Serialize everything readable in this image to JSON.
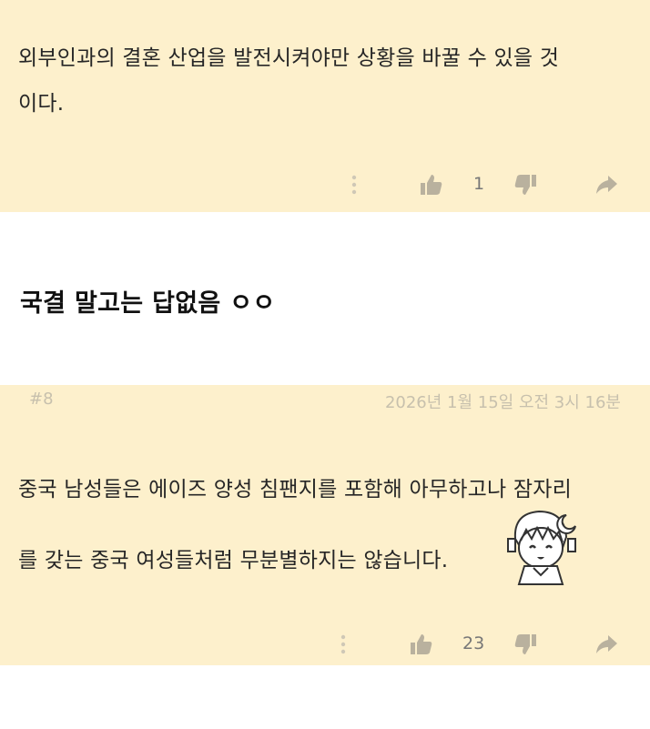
{
  "top_comment": {
    "text_lines": [
      "외부인과의 결혼 산업을 발전시켜야만 상황을 바꿀 수 있을 것",
      "이다."
    ],
    "like_count": "1"
  },
  "standalone_text": "국결 말고는 답없음 ㅇㅇ",
  "comment": {
    "index": "#8",
    "date": "2026년 1월 15일 오전 3시 16분",
    "text_lines": [
      "중국 남성들은 에이즈 양성 침팬지를 포함해 아무하고나 잠자리",
      "를 갖는 중국 여성들처럼 무분별하지는 않습니다."
    ],
    "like_count": "23",
    "sticker": "anime-girl-sticker-icon"
  },
  "icons": {
    "more": "more-vertical-icon",
    "like": "thumbs-up-icon",
    "dislike": "thumbs-down-icon",
    "share": "share-arrow-icon"
  },
  "colors": {
    "card_background": "#fdf0cc",
    "icon_color": "#b9b19e",
    "meta_text": "#c7c0ad"
  }
}
